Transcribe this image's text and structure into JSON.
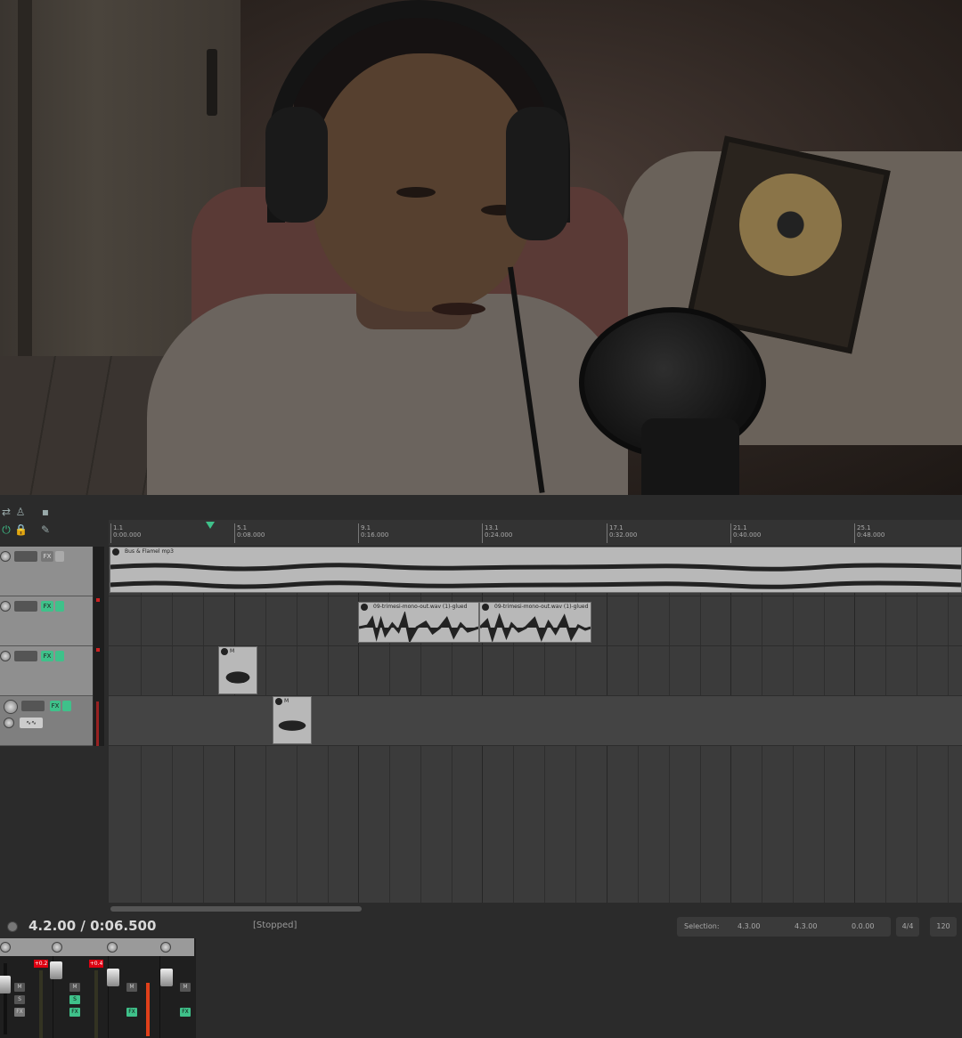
{
  "ruler": {
    "marks": [
      {
        "bar": "1.1",
        "time": "0:00.000"
      },
      {
        "bar": "5.1",
        "time": "0:08.000"
      },
      {
        "bar": "9.1",
        "time": "0:16.000"
      },
      {
        "bar": "13.1",
        "time": "0:24.000"
      },
      {
        "bar": "17.1",
        "time": "0:32.000"
      },
      {
        "bar": "21.1",
        "time": "0:40.000"
      },
      {
        "bar": "25.1",
        "time": "0:48.000"
      }
    ]
  },
  "tracks": [
    {
      "name_badge": "M",
      "fx_label": "FX",
      "items": [
        {
          "label": "Bus & Flamel mp3"
        }
      ]
    },
    {
      "fx_label": "FX",
      "items": [
        {
          "label": "09-trimesi-mono-out.wav (1)-glued"
        },
        {
          "label": "09-trimesi-mono-out.wav (1)-glued"
        }
      ]
    },
    {
      "fx_label": "FX",
      "items": [
        {
          "label": "M"
        }
      ]
    },
    {
      "fx_label": "FX",
      "items": [
        {
          "label": "M"
        }
      ]
    }
  ],
  "transport": {
    "time": "4.2.00 / 0:06.500",
    "status": "[Stopped]",
    "selection_label": "Selection:",
    "selection_start": "4.3.00",
    "selection_end": "4.3.00",
    "selection_length": "0.0.00",
    "time_signature": "4/4",
    "tempo": "120"
  },
  "mixer": {
    "peaks": [
      "+0.2",
      "+0.4"
    ]
  },
  "colors": {
    "accent": "#3fc18a",
    "item": "#b8b8b8",
    "track_bg": "#3b3b3b",
    "peak": "#d01020"
  }
}
